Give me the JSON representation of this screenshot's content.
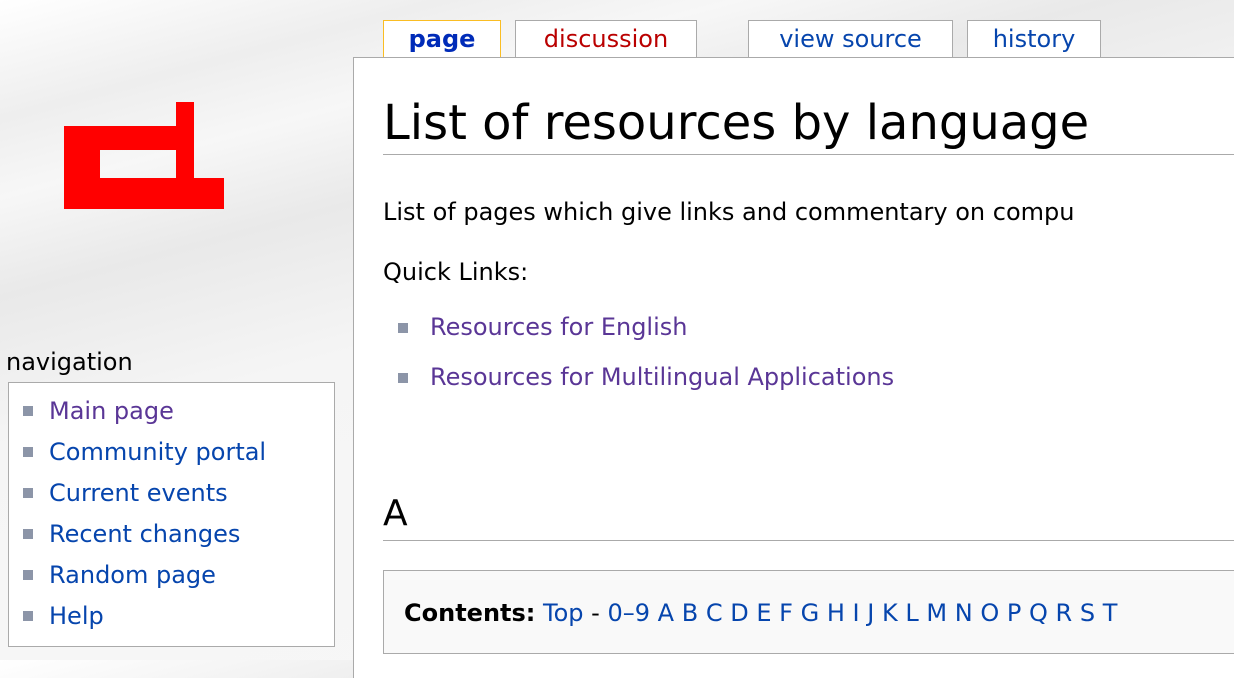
{
  "logo": {
    "color": "#ff0000",
    "name": "site-logo"
  },
  "tabs": [
    {
      "label": "page",
      "selected": true
    },
    {
      "label": "discussion",
      "status": "new"
    },
    {
      "label": "view source"
    },
    {
      "label": "history"
    }
  ],
  "main": {
    "title": "List of resources by language",
    "intro": "List of pages which give links and commentary on compu",
    "quick_links_label": "Quick Links:",
    "quick_links": [
      "Resources for English",
      "Resources for Multilingual Applications"
    ],
    "section_heading": "A",
    "toc": {
      "label": "Contents:",
      "top": "Top",
      "separator": " - ",
      "letters": [
        "0–9",
        "A",
        "B",
        "C",
        "D",
        "E",
        "F",
        "G",
        "H",
        "I",
        "J",
        "K",
        "L",
        "M",
        "N",
        "O",
        "P",
        "Q",
        "R",
        "S",
        "T"
      ]
    }
  },
  "navigation": {
    "heading": "navigation",
    "items": [
      "Main page",
      "Community portal",
      "Current events",
      "Recent changes",
      "Random page",
      "Help"
    ]
  },
  "colors": {
    "link": "#0645ad",
    "visited_link": "#5a3696",
    "new_link": "#ba0000",
    "selected_tab_border": "#fabd23"
  }
}
